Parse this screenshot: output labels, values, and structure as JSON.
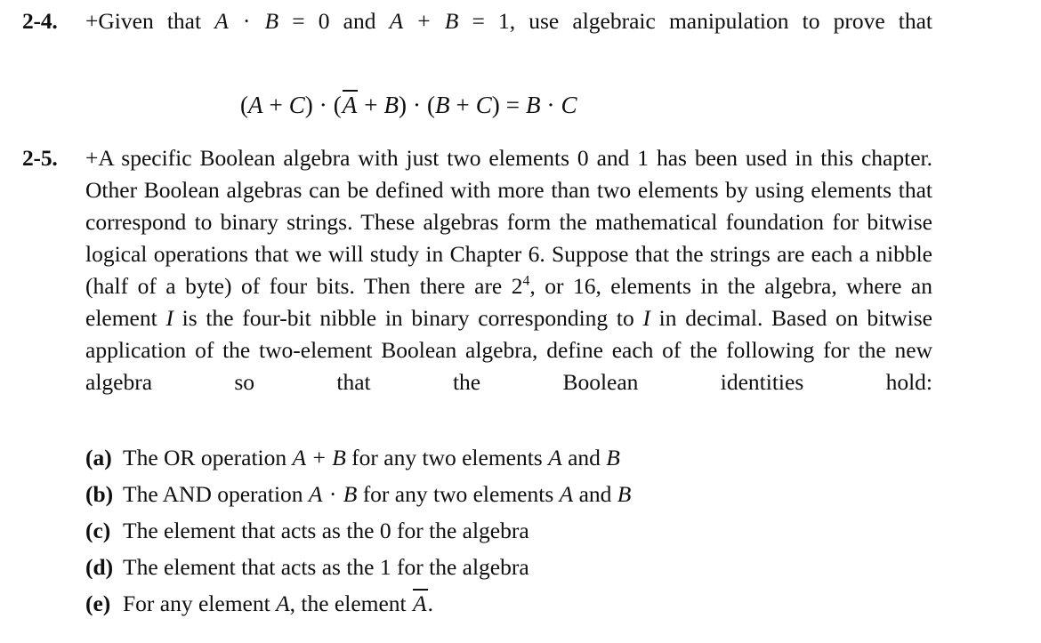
{
  "page": {
    "background_color": "#ffffff",
    "text_color": "#100f10"
  },
  "problems": [
    {
      "number": "2-4.",
      "paragraph_prefix": "+Given that ",
      "paragraph_parts": {
        "p1": "+Given that ",
        "var_a1": "A",
        "dot1": " · ",
        "var_b1": "B",
        "eq1": " = 0 and ",
        "var_a2": "A",
        "plus1": " + ",
        "var_b2": "B",
        "eq2": " = 1, use algebraic manipulation to prove that"
      },
      "display_equation": {
        "tokens": [
          "(",
          "A",
          " + ",
          "C",
          ")",
          " · ",
          "(",
          "A",
          " + ",
          "B",
          ")",
          " · ",
          "(",
          "B",
          " + ",
          "C",
          ")",
          " = ",
          "B",
          " · ",
          "C"
        ],
        "plain": "(A + C) · (A̅ + B) · (B + C) = B · C",
        "lparen": "(",
        "rparen": ")",
        "plus": "+",
        "dot": "·",
        "equals": "=",
        "var_a": "A",
        "var_b": "B",
        "var_c": "C",
        "a_bar": "A"
      }
    },
    {
      "number": "2-5.",
      "paragraph": {
        "s1": "+A specific Boolean algebra with just two elements 0 and 1 has been used in this chapter. Other Boolean algebras can be defined with more than two elements by using elements that correspond to binary strings. These algebras form the mathematical foundation for bitwise logical operations that we will study in Chapter 6. Suppose that the strings are each a nibble (half of a byte) of four bits. Then there are 2",
        "exp": "4",
        "s2": ", or 16, elements in the algebra, where an element ",
        "var_i1": "I",
        "s3": " is the four-bit nibble in binary corresponding to ",
        "var_i2": "I",
        "s4": " in decimal. Based on bitwise application of the two-element Boolean algebra, define each of the following for the new algebra so that the Boolean identities hold:"
      },
      "subitems": [
        {
          "label": "(a)",
          "t1": "The OR operation ",
          "v1": "A",
          "op": " + ",
          "v2": "B",
          "t2": " for any two elements ",
          "v3": "A",
          "t3": " and ",
          "v4": "B",
          "plain": "The OR operation A + B for any two elements A and B"
        },
        {
          "label": "(b)",
          "t1": "The AND operation ",
          "v1": "A",
          "op": " · ",
          "v2": "B",
          "t2": " for any two elements ",
          "v3": "A",
          "t3": " and ",
          "v4": "B",
          "plain": "The AND operation A · B for any two elements A and B"
        },
        {
          "label": "(c)",
          "t1": "The element that acts as the 0 for the algebra",
          "plain": "The element that acts as the 0 for the algebra"
        },
        {
          "label": "(d)",
          "t1": "The element that acts as the 1 for the algebra",
          "plain": "The element that acts as the 1 for the algebra"
        },
        {
          "label": "(e)",
          "t1": "For any element ",
          "v1": "A",
          "t2": ", the element ",
          "v2": "A",
          "t3": ".",
          "plain": "For any element A, the element A̅."
        }
      ]
    }
  ]
}
